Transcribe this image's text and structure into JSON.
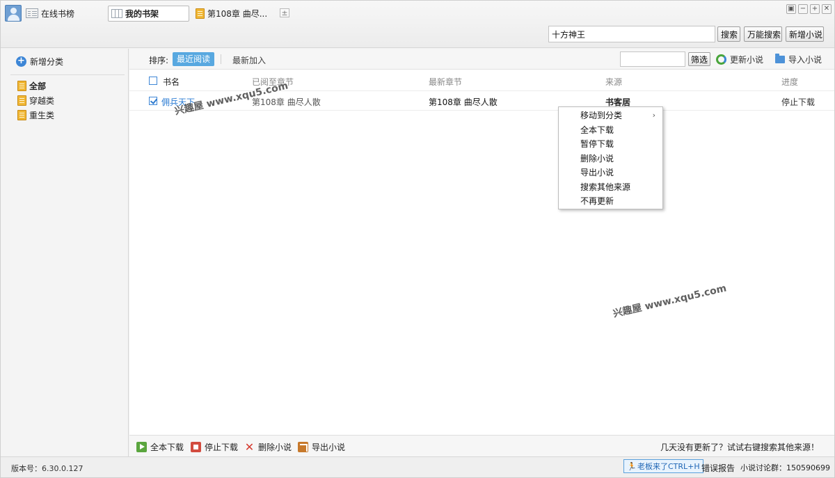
{
  "header": {
    "tabs": {
      "online": "在线书榜",
      "shelf": "我的书架",
      "chapter": "第108章  曲尽..."
    },
    "add_tab_symbol": "±",
    "window_buttons": [
      "▣",
      "−",
      "+",
      "✕"
    ],
    "search": {
      "value": "十方神王",
      "button": "搜索",
      "universal_button": "万能搜索",
      "add_novel_button": "新增小说"
    }
  },
  "sidebar": {
    "add_category": "新增分类",
    "categories": [
      {
        "label": "全部",
        "active": true
      },
      {
        "label": "穿越类",
        "active": false
      },
      {
        "label": "重生类",
        "active": false
      }
    ]
  },
  "toolbar": {
    "sort_label": "排序:",
    "sort_recent_read": "最近阅读",
    "sort_recent_added": "最新加入",
    "filter_button": "筛选",
    "refresh": "更新小说",
    "import": "导入小说"
  },
  "table": {
    "columns": {
      "name": "书名",
      "read_to": "已阅至章节",
      "latest": "最新章节",
      "source": "来源",
      "progress": "进度"
    },
    "rows": [
      {
        "checked": true,
        "name": "佣兵天下",
        "read_to": "第108章  曲尽人散",
        "latest": "第108章  曲尽人散",
        "source": "书客居",
        "progress": "停止下载"
      }
    ]
  },
  "context_menu": {
    "items": [
      "移动到分类",
      "全本下载",
      "暂停下载",
      "删除小说",
      "导出小说",
      "搜索其他来源",
      "不再更新"
    ],
    "submenu_arrow": "›"
  },
  "watermarks": [
    "兴趣屋 www.xqu5.com",
    "兴趣屋 www.xqu5.com"
  ],
  "bottom_bar": {
    "full_download": "全本下载",
    "stop_download": "停止下载",
    "delete": "删除小说",
    "export": "导出小说",
    "tip": "几天没有更新了？试试右键搜索其他来源！"
  },
  "statusbar": {
    "version": "版本号：6.30.0.127",
    "boss_key": "老板来了CTRL+H",
    "error_report": "错误报告",
    "discussion_group": "小说讨论群：150590699"
  },
  "colors": {
    "accent": "#58a8e0",
    "link": "#2a7bd3",
    "checkbox": "#3d86d6"
  },
  "icons": {
    "user": "avatar-icon",
    "online": "list-icon",
    "shelf": "bookshelf-icon",
    "chapter": "book-icon",
    "add_category": "plus-circle-icon",
    "category": "book-icon",
    "refresh": "refresh-icon",
    "import": "folder-icon",
    "full_download": "download-icon",
    "stop_download": "stop-icon",
    "delete": "close-icon",
    "export": "export-icon",
    "boss_key": "running-man-icon"
  }
}
